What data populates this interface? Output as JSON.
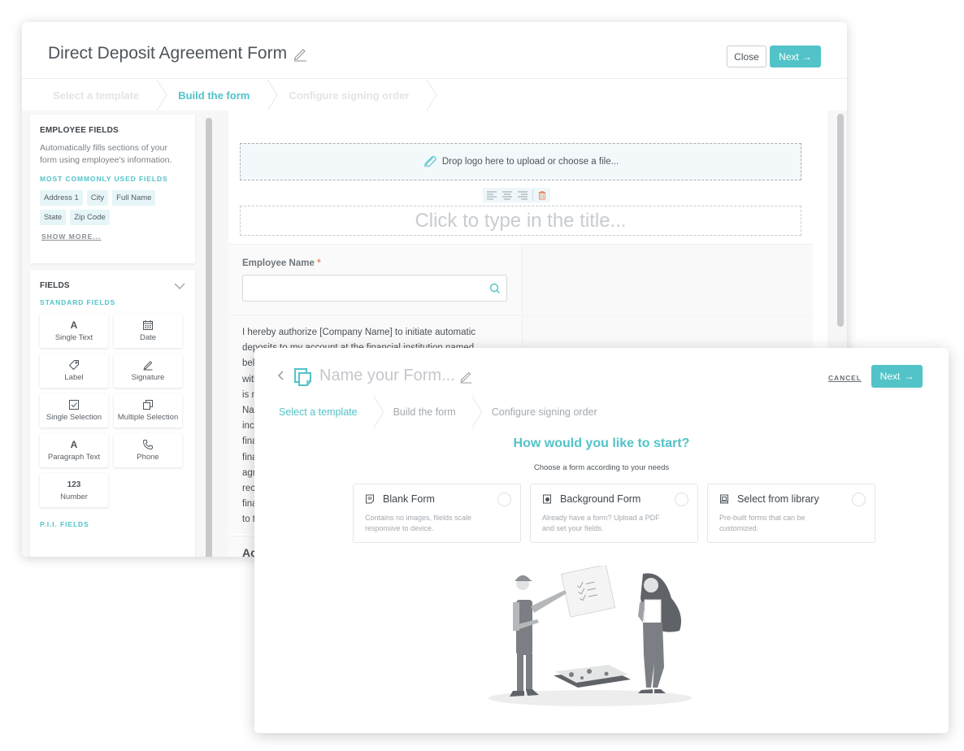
{
  "builder": {
    "title": "Direct Deposit Agreement Form",
    "close_label": "Close",
    "next_label": "Next",
    "steps": [
      {
        "label": "Select a template",
        "state": "done"
      },
      {
        "label": "Build the form",
        "state": "active"
      },
      {
        "label": "Configure signing order",
        "state": "upcoming"
      }
    ],
    "sidebar": {
      "employee_fields": {
        "title": "EMPLOYEE FIELDS",
        "description": "Automatically fills sections of your form using employee's information.",
        "common_label": "MOST COMMONLY USED FIELDS",
        "chips": [
          "Address 1",
          "City",
          "Full Name",
          "State",
          "Zip Code"
        ],
        "show_more": "SHOW MORE..."
      },
      "fields": {
        "title": "FIELDS",
        "standard_label": "STANDARD FIELDS",
        "items": [
          {
            "label": "Single Text",
            "icon": "text-a-icon",
            "glyph": "A"
          },
          {
            "label": "Date",
            "icon": "calendar-icon",
            "glyph": ""
          },
          {
            "label": "Label",
            "icon": "tag-icon",
            "glyph": ""
          },
          {
            "label": "Signature",
            "icon": "signature-pen-icon",
            "glyph": ""
          },
          {
            "label": "Single Selection",
            "icon": "checkbox-icon",
            "glyph": ""
          },
          {
            "label": "Multiple Selection",
            "icon": "multi-copy-icon",
            "glyph": ""
          },
          {
            "label": "Paragraph Text",
            "icon": "text-a-icon",
            "glyph": "A"
          },
          {
            "label": "Phone",
            "icon": "phone-icon",
            "glyph": ""
          },
          {
            "label": "Number",
            "icon": "number-icon",
            "glyph": "123"
          }
        ],
        "pii_label": "P.I.I. FIELDS"
      }
    },
    "canvas": {
      "logo_drop": "Drop logo here to upload or choose a file...",
      "title_placeholder": "Click to type in the title...",
      "employee_name_label": "Employee Name",
      "required_mark": "*",
      "authorization_text": "I hereby authorize [Company Name] to initiate automatic deposits to my account at the financial institution named below. I also authorize [Company Name] to make withdrawals from this account in the event that a credit entry is made in error. Further, I agree not to hold [Company Name] responsible for any delay or loss of funds due to incorrect or incomplete information supplied by me or by my financial institution or due to an error on the part of my financial institution in depositing funds to my account. This agreement will remain in effect until [Company Name] receives a written notice of cancellation from me or my financial institution, or until I submit a new direct deposit form to the Payroll Department.",
      "next_section_text": "Ac"
    }
  },
  "wizard": {
    "title_placeholder": "Name your Form...",
    "cancel_label": "CANCEL",
    "next_label": "Next",
    "steps": [
      {
        "label": "Select a template",
        "state": "active"
      },
      {
        "label": "Build the form",
        "state": "upcoming"
      },
      {
        "label": "Configure signing order",
        "state": "upcoming"
      }
    ],
    "heading": "How would you like to start?",
    "subheading": "Choose a form according to your needs",
    "options": [
      {
        "title": "Blank Form",
        "description": "Contains no images, filelds scale responsive to device.",
        "icon": "blank-form-icon",
        "selected": false
      },
      {
        "title": "Background Form",
        "description": "Already have a form? Upload a PDF and set your fields.",
        "icon": "background-form-icon",
        "selected": false
      },
      {
        "title": "Select from library",
        "description": "Pre-built forms that can be customized.",
        "icon": "library-icon",
        "selected": false
      }
    ]
  },
  "colors": {
    "accent": "#52c3c8",
    "required": "#f08a60",
    "delete": "#e8825a",
    "text_dark": "#4d545a",
    "muted": "#a4a9ae"
  }
}
